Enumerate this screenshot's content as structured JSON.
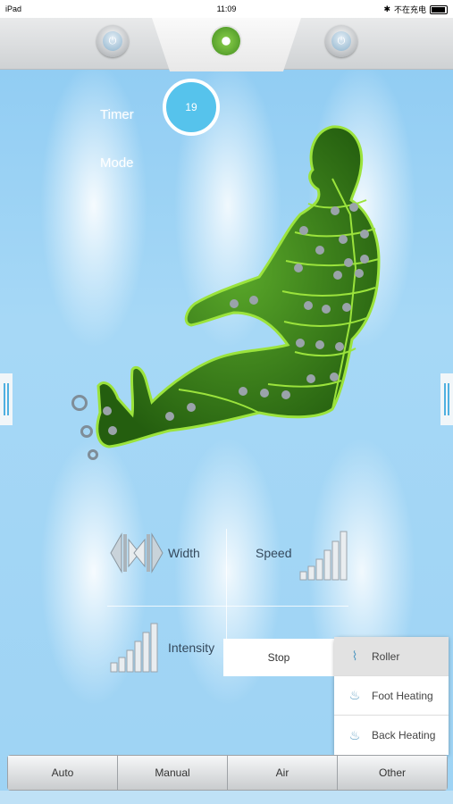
{
  "statusbar": {
    "device": "iPad",
    "time": "11:09",
    "charging": "不在充电"
  },
  "header": {
    "left_button_icon": "power-icon",
    "logo_icon": "hand-logo-icon",
    "right_button_icon": "power-icon"
  },
  "main": {
    "timer_label": "Timer",
    "timer_value": "19",
    "mode_label": "Mode"
  },
  "controls": {
    "width_label": "Width",
    "speed_label": "Speed",
    "intensity_label": "Intensity",
    "stop_label": "Stop"
  },
  "menu": {
    "items": [
      {
        "label": "Roller",
        "icon": "roller-icon",
        "selected": true
      },
      {
        "label": "Foot Heating",
        "icon": "heating-icon",
        "selected": false
      },
      {
        "label": "Back Heating",
        "icon": "heating-icon",
        "selected": false
      }
    ]
  },
  "tabs": [
    {
      "label": "Auto"
    },
    {
      "label": "Manual"
    },
    {
      "label": "Air"
    },
    {
      "label": "Other"
    }
  ],
  "colors": {
    "background": "#9ed3f4",
    "body_green": "#3f8a1d",
    "outline_green": "#9be33c",
    "timer_blue": "#56c3ec"
  }
}
